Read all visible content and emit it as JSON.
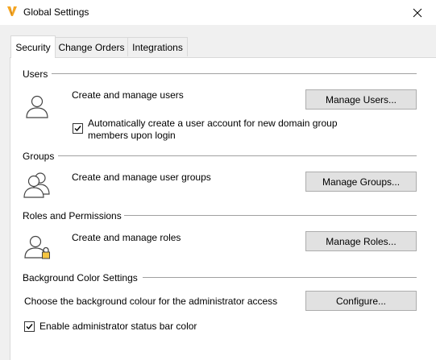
{
  "window": {
    "title": "Global Settings",
    "app_icon": "app-logo-icon",
    "close_icon": "close-icon"
  },
  "tabs": [
    {
      "label": "Security",
      "active": true
    },
    {
      "label": "Change Orders",
      "active": false
    },
    {
      "label": "Integrations",
      "active": false
    }
  ],
  "sections": {
    "users": {
      "heading": "Users",
      "description": "Create and manage users",
      "button": "Manage Users...",
      "checkbox_label": "Automatically create a user account for new domain group members upon login",
      "checkbox_checked": true,
      "icon": "user-icon"
    },
    "groups": {
      "heading": "Groups",
      "description": "Create and manage user groups",
      "button": "Manage Groups...",
      "icon": "group-icon"
    },
    "roles": {
      "heading": "Roles and Permissions",
      "description": "Create and manage roles",
      "button": "Manage Roles...",
      "icon": "user-lock-icon"
    },
    "background": {
      "heading": "Background Color Settings",
      "description": "Choose the background colour for the administrator access",
      "button": "Configure...",
      "checkbox_label": "Enable administrator status bar color",
      "checkbox_checked": true
    }
  },
  "colors": {
    "accent_orange": "#f5a623",
    "window_bg": "#f0f0f0",
    "button_bg": "#e1e1e1"
  }
}
